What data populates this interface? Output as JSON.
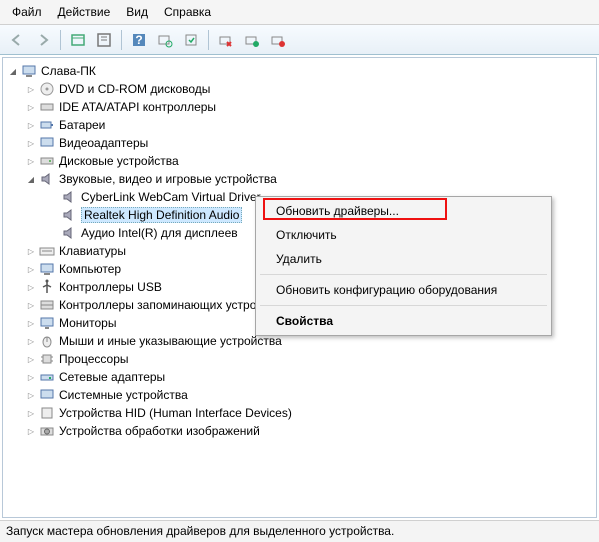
{
  "menu": {
    "file": "Файл",
    "action": "Действие",
    "view": "Вид",
    "help": "Справка"
  },
  "tree": {
    "root": "Слава-ПК",
    "items": [
      "DVD и CD-ROM дисководы",
      "IDE ATA/ATAPI контроллеры",
      "Батареи",
      "Видеоадаптеры",
      "Дисковые устройства"
    ],
    "audio_group": "Звуковые, видео и игровые устройства",
    "audio_children": [
      "CyberLink WebCam Virtual Driver",
      "Realtek High Definition Audio",
      "Аудио Intel(R) для дисплеев"
    ],
    "rest": [
      "Клавиатуры",
      "Компьютер",
      "Контроллеры USB",
      "Контроллеры запоминающих устройств",
      "Мониторы",
      "Мыши и иные указывающие устройства",
      "Процессоры",
      "Сетевые адаптеры",
      "Системные устройства",
      "Устройства HID (Human Interface Devices)",
      "Устройства обработки изображений"
    ]
  },
  "context_menu": {
    "update": "Обновить драйверы...",
    "disable": "Отключить",
    "delete": "Удалить",
    "scan": "Обновить конфигурацию оборудования",
    "properties": "Свойства"
  },
  "statusbar": "Запуск мастера обновления драйверов для выделенного устройства."
}
